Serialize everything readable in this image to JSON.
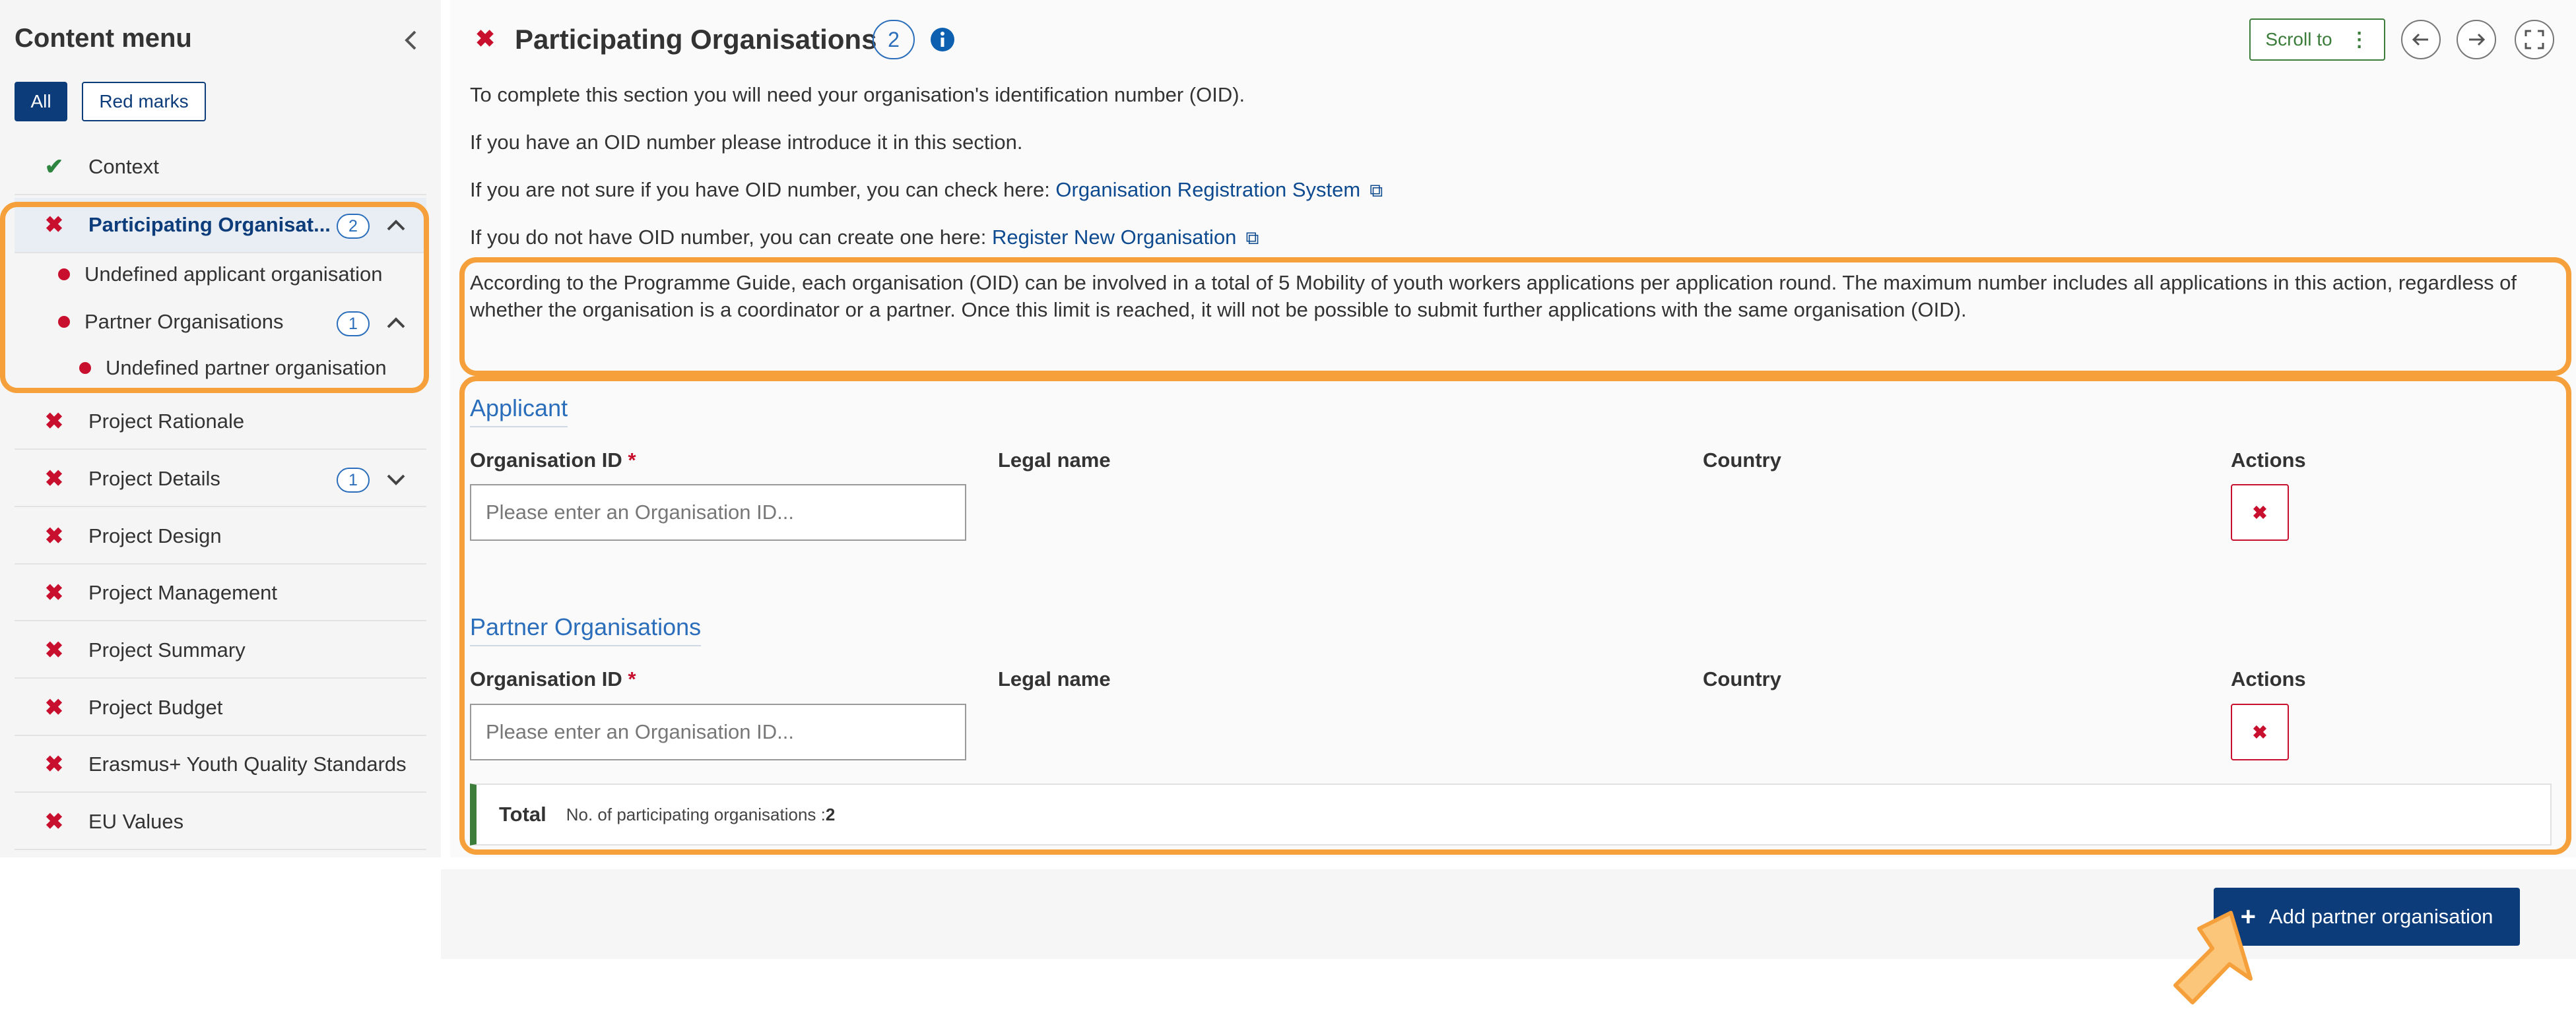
{
  "sidebar": {
    "title": "Content menu",
    "filters": {
      "all": "All",
      "red_marks": "Red marks"
    },
    "items": [
      {
        "label": "Context",
        "status": "complete"
      },
      {
        "label": "Participating Organisat...",
        "status": "error",
        "badge": "2"
      },
      {
        "label": "Project Rationale",
        "status": "error"
      },
      {
        "label": "Project Details",
        "status": "error",
        "badge": "1"
      },
      {
        "label": "Project Design",
        "status": "error"
      },
      {
        "label": "Project Management",
        "status": "error"
      },
      {
        "label": "Project Summary",
        "status": "error"
      },
      {
        "label": "Project Budget",
        "status": "error"
      },
      {
        "label": "Erasmus+ Youth Quality Standards",
        "status": "error"
      },
      {
        "label": "EU Values",
        "status": "error"
      }
    ],
    "subitems": {
      "applicant": "Undefined applicant organisation",
      "partners": "Partner Organisations",
      "partners_badge": "1",
      "partner": "Undefined partner organisation"
    }
  },
  "section": {
    "title": "Participating Organisations",
    "badge": "2",
    "scroll_to": "Scroll to"
  },
  "intro": {
    "line1": "To complete this section you will need your organisation's identification number (OID).",
    "line2": "If you have an OID number please introduce it in this section.",
    "line3_text": "If you are not sure if you have OID number, you can check here: ",
    "line3_link": "Organisation Registration System",
    "line4_text": "If you do not have OID number, you can create one here: ",
    "line4_link": "Register New Organisation"
  },
  "note": "According to the Programme Guide, each organisation (OID) can be involved in a total of 5 Mobility of youth workers applications per application round. The maximum number includes all applications in this action, regardless of whether the organisation is a coordinator or a partner. Once this limit is reached, it will not be possible to submit further applications with the same organisation (OID).",
  "applicant": {
    "heading": "Applicant",
    "columns": {
      "oid": "Organisation ID",
      "required": "*",
      "legal": "Legal name",
      "country": "Country",
      "actions": "Actions"
    },
    "placeholder": "Please enter an Organisation ID..."
  },
  "partners": {
    "heading": "Partner Organisations",
    "columns": {
      "oid": "Organisation ID",
      "required": "*",
      "legal": "Legal name",
      "country": "Country",
      "actions": "Actions"
    },
    "placeholder": "Please enter an Organisation ID..."
  },
  "total": {
    "label": "Total",
    "text": "No. of participating organisations : ",
    "count": "2"
  },
  "add_button": "Add partner organisation",
  "colors": {
    "accent": "#0d3c7a",
    "error": "#c8102e",
    "highlight": "#f5a03a",
    "success": "#2e8540"
  }
}
